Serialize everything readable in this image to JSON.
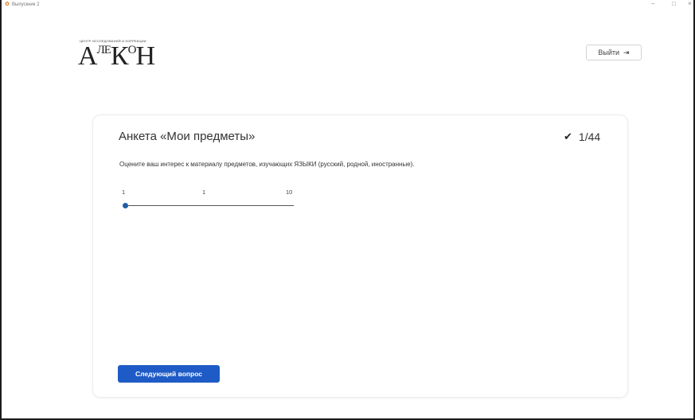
{
  "window": {
    "title": "Выпускник 2",
    "app_icon": "pinwheel-icon",
    "controls": {
      "minimize": "–",
      "maximize": "□",
      "close": "×"
    }
  },
  "header": {
    "logo_tagline": "ЦЕНТР ИССЛЕДОВАНИЙ И КОРРЕКЦИИ",
    "logo_text": [
      "А",
      "ЛЕ",
      "К",
      "О",
      "Н"
    ],
    "logout_label": "Выйти",
    "logout_icon": "logout-icon"
  },
  "survey": {
    "title": "Анкета «Мои предметы»",
    "progress": "1/44",
    "question": "Оцените ваш интерес к материалу предметов, изучающих ЯЗЫКИ (русский, родной, иностранные).",
    "slider": {
      "min_label": "1",
      "current_label": "1",
      "max_label": "10",
      "min": 1,
      "max": 10,
      "value": 1
    },
    "next_label": "Следующий вопрос"
  },
  "colors": {
    "accent": "#1e5bc6",
    "slider_thumb": "#1f5fa6"
  }
}
